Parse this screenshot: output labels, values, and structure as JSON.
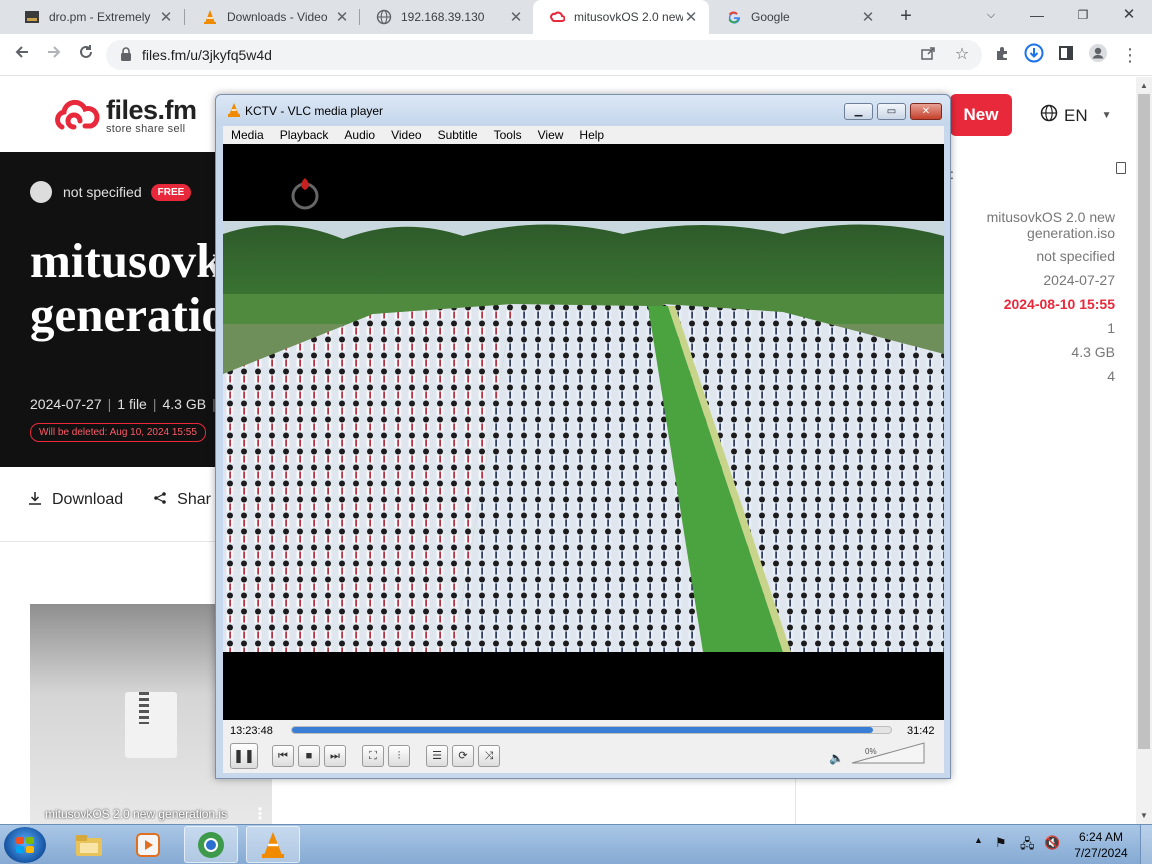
{
  "browser": {
    "tabs": [
      {
        "title": "dro.pm - Extremely",
        "icon": "dropm-icon"
      },
      {
        "title": "Downloads - Video",
        "icon": "vlc-cone-icon"
      },
      {
        "title": "192.168.39.130",
        "icon": "globe-icon"
      },
      {
        "title": "mitusovkOS 2.0 new",
        "icon": "filesfm-icon"
      },
      {
        "title": "Google",
        "icon": "google-icon"
      }
    ],
    "new_tab": "+",
    "url": "files.fm/u/3jkyfq5w4d"
  },
  "site": {
    "logo_name": "files.fm",
    "logo_tagline": "store share sell",
    "new_button": "New",
    "lang": "EN",
    "owner": "not specified",
    "free_badge": "FREE",
    "title_line1": "mitusovk",
    "title_line2": "generatio",
    "meta": {
      "date": "2024-07-27",
      "files": "1 file",
      "size": "4.3 GB"
    },
    "delete_note": "Will be deleted: Aug 10, 2024 15:55",
    "actions": {
      "download": "Download",
      "share": "Shar"
    },
    "thumb_name": "mitusovkOS 2.0 new generation.is",
    "panel": {
      "colon": ":",
      "name_line1": "mitusovkOS 2.0 new",
      "name_line2": "generation.iso",
      "owner": "not specified",
      "uploaded": "2024-07-27",
      "expires": "2024-08-10 15:55",
      "files": "1",
      "size": "4.3 GB",
      "count": "4"
    }
  },
  "vlc": {
    "title": "KCTV - VLC media player",
    "menu": [
      "Media",
      "Playback",
      "Audio",
      "Video",
      "Subtitle",
      "Tools",
      "View",
      "Help"
    ],
    "time_elapsed": "13:23:48",
    "time_total": "31:42",
    "progress_fraction": 0.97,
    "volume": "0%"
  },
  "taskbar": {
    "time": "6:24 AM",
    "date": "7/27/2024"
  },
  "colors": {
    "brand_red": "#e8293b",
    "vlc_seek": "#3a7dd4"
  }
}
